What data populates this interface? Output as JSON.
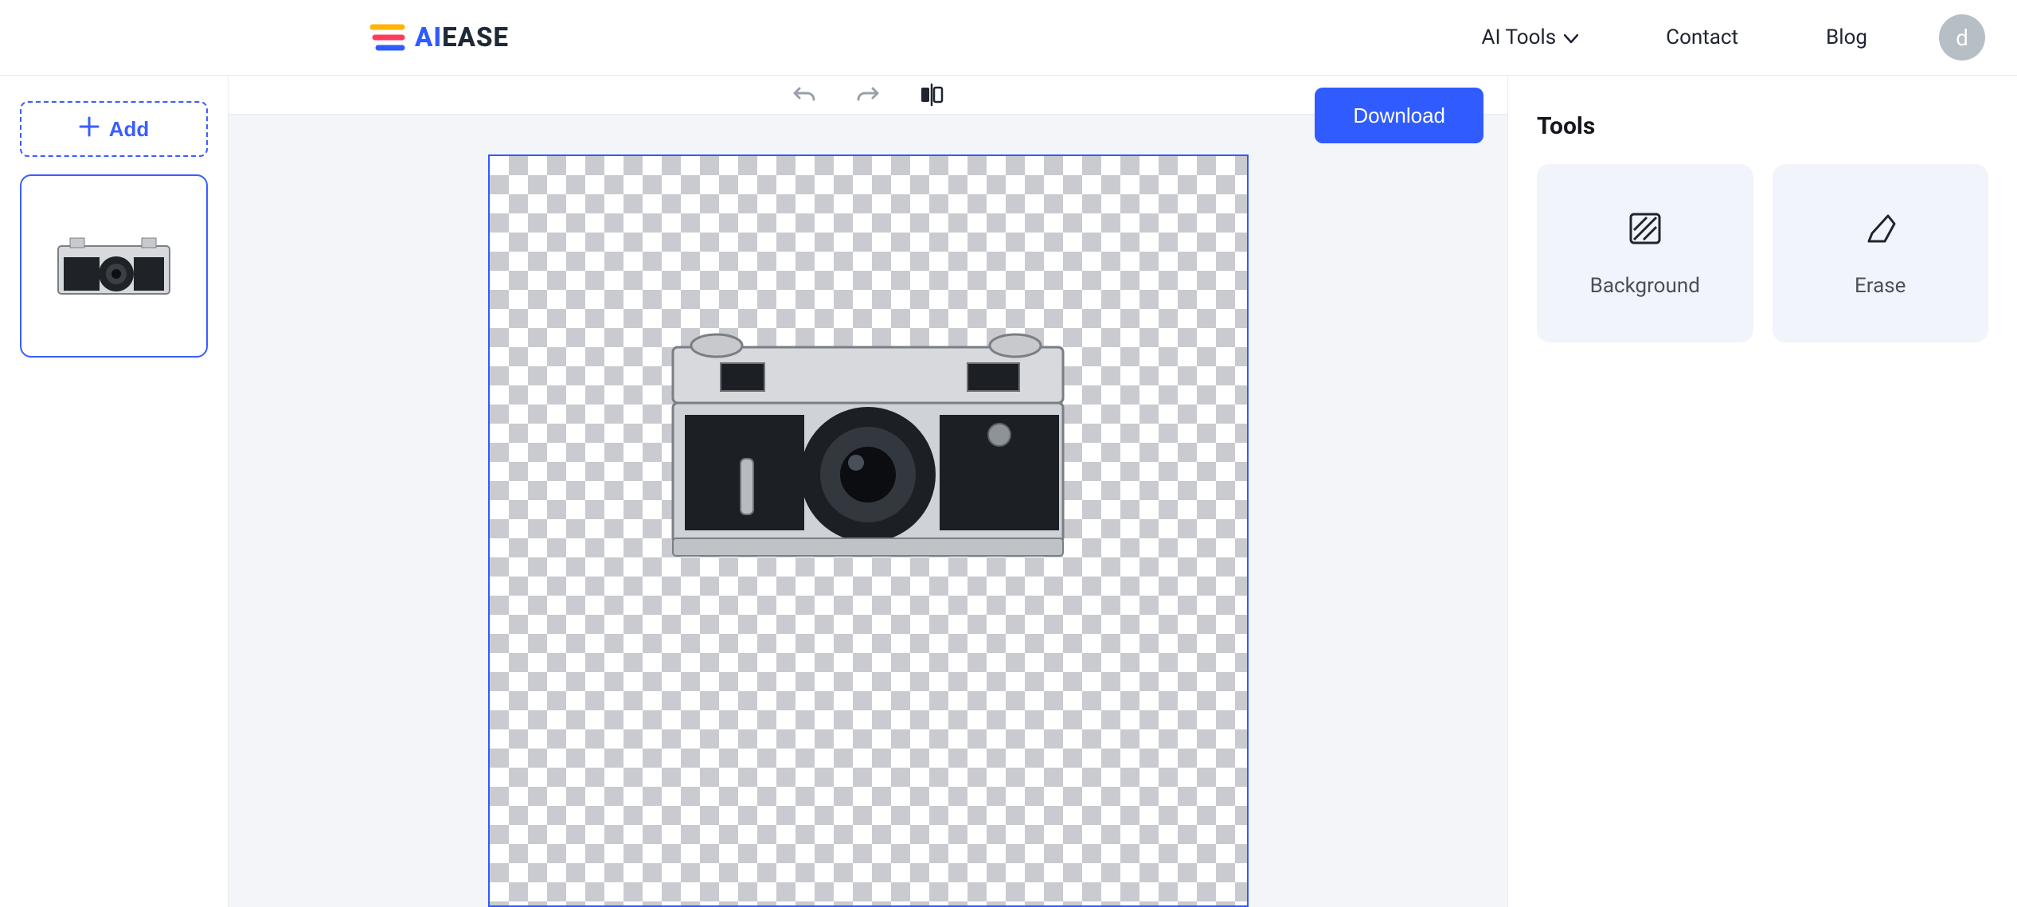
{
  "brand": {
    "name_ai": "AI",
    "name_rest": "EASE"
  },
  "nav": {
    "ai_tools": "AI Tools",
    "contact": "Contact",
    "blog": "Blog",
    "avatar_initial": "d"
  },
  "sidebar": {
    "add_label": "Add"
  },
  "topbar": {
    "download_label": "Download"
  },
  "tools": {
    "title": "Tools",
    "background_label": "Background",
    "erase_label": "Erase"
  }
}
